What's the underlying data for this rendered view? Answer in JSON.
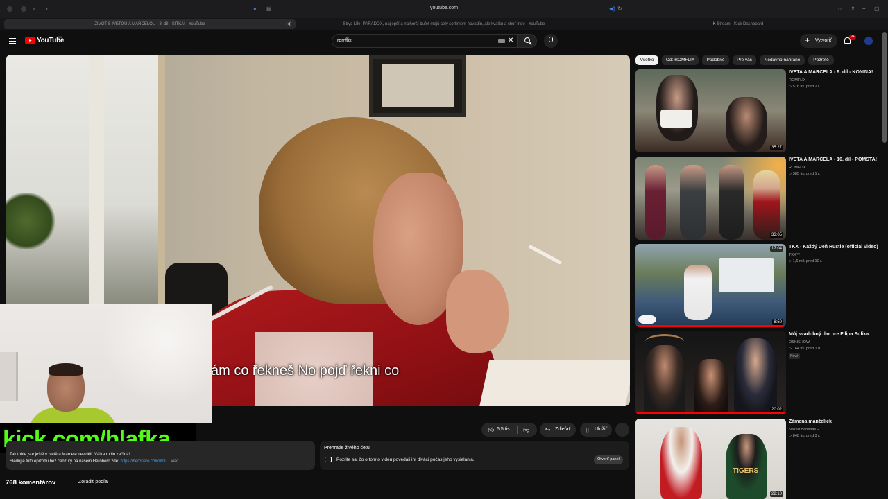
{
  "browser": {
    "url": "youtube.com",
    "tabs": [
      {
        "label": "ŽIVOT S IVETOU A MARCELOU - 8. díl - SITKA! - YouTube"
      },
      {
        "label": "Stryc Life: PARADOX, najlepší a najhorší bufet majú celý sortiment hovadín, ale kvalitu a chuť inde - YouTube"
      },
      {
        "label": "Stream - Kick Dashboard"
      }
    ]
  },
  "header": {
    "logo_text": "YouTube",
    "country": "SK",
    "search_value": "romflix",
    "create_label": "Vytvoriť",
    "notif_count": "9+"
  },
  "player": {
    "subtitle": "ám co řekneš No pojď řekni co"
  },
  "stream_overlay": {
    "kick_text": "kick.com/hlafka"
  },
  "actions": {
    "like_count": "6,5 tis.",
    "share_label": "Zdieľať",
    "save_label": "Uložiť"
  },
  "description": {
    "line1": "Tak tohle jste ještě v Ivetě a Marcele neviděli. Válka rodin začíná!",
    "line2": "Sledujte tuto epizodu bez cenzury na našem Herohero zde:",
    "link": "https://herohero.co/romfli",
    "more": "...viac"
  },
  "live_chat": {
    "title": "Prehratie živého četu",
    "text": "Pozrite sa, čo o tomto videu povedali iní diváci počas jeho vysielania.",
    "open_label": "Otvoriť panel"
  },
  "comments": {
    "count": "768 komentárov",
    "sort_label": "Zoradiť podľa"
  },
  "chips": [
    "Všetko",
    "Od: ROMFLIX",
    "Podobné",
    "Pre vás",
    "Nedávno nahrané",
    "Pozreté"
  ],
  "related": [
    {
      "title": "IVETA A MARCELA - 9. díl - KONINA!",
      "channel": "ROMFLIX",
      "meta": "▷ 576 tis.   pred 2 r.",
      "duration": "35:27"
    },
    {
      "title": "IVETA A MARCELA - 10. díl - POMSTA!",
      "channel": "ROMFLIX",
      "meta": "▷ 385 tis.   pred 1 r.",
      "duration": "33:05"
    },
    {
      "title": "TKX - Každý Deň Hustle (official video)",
      "channel": "TKX™",
      "meta": "▷ 1,6 mil.   pred 10 r.",
      "duration": "8:50",
      "overlay": "17:04"
    },
    {
      "title": "Môj svadobný dar pre Filipa Sulika.",
      "channel": "OSKISHOW",
      "meta": "▷ 164 tis.   pred 1 d.",
      "duration": "20:02",
      "badge": "Nové"
    },
    {
      "title": "Zámena manželiek",
      "channel": "Naked Bananas ✓",
      "meta": "▷ 848 tis.   pred 3 r.",
      "duration": "22:10"
    }
  ],
  "colors": {
    "accent": "#ff0000",
    "kick_green": "#53fc18",
    "link_blue": "#3ea6ff"
  }
}
